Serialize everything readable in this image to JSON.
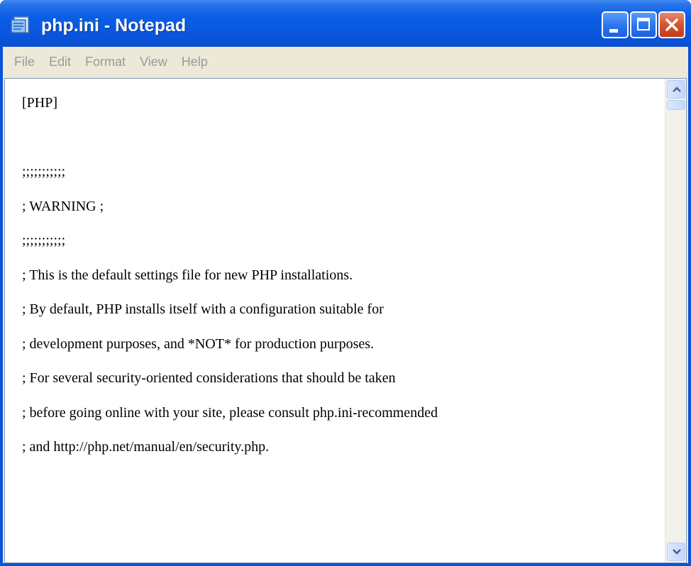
{
  "window": {
    "title": "php.ini - Notepad"
  },
  "menu": [
    "File",
    "Edit",
    "Format",
    "View",
    "Help"
  ],
  "editor": {
    "lines": [
      "[PHP]",
      "",
      ";;;;;;;;;;;",
      "; WARNING ;",
      ";;;;;;;;;;;",
      "; This is the default settings file for new PHP installations.",
      "; By default, PHP installs itself with a configuration suitable for",
      "; development purposes, and *NOT* for production purposes.",
      "; For several security-oriented considerations that should be taken",
      "; before going online with your site, please consult php.ini-recommended",
      "; and http://php.net/manual/en/security.php."
    ]
  },
  "icons": {
    "app": "notepad-icon",
    "minimize": "minimize-icon",
    "maximize": "maximize-icon",
    "close": "close-icon",
    "scroll_up": "chevron-up-icon",
    "scroll_down": "chevron-down-icon"
  },
  "colors": {
    "titlebar": "#0a5fe4",
    "close_button": "#d7532f",
    "menu_background": "#ece9d8",
    "menu_text_disabled": "#9a9a9a"
  }
}
